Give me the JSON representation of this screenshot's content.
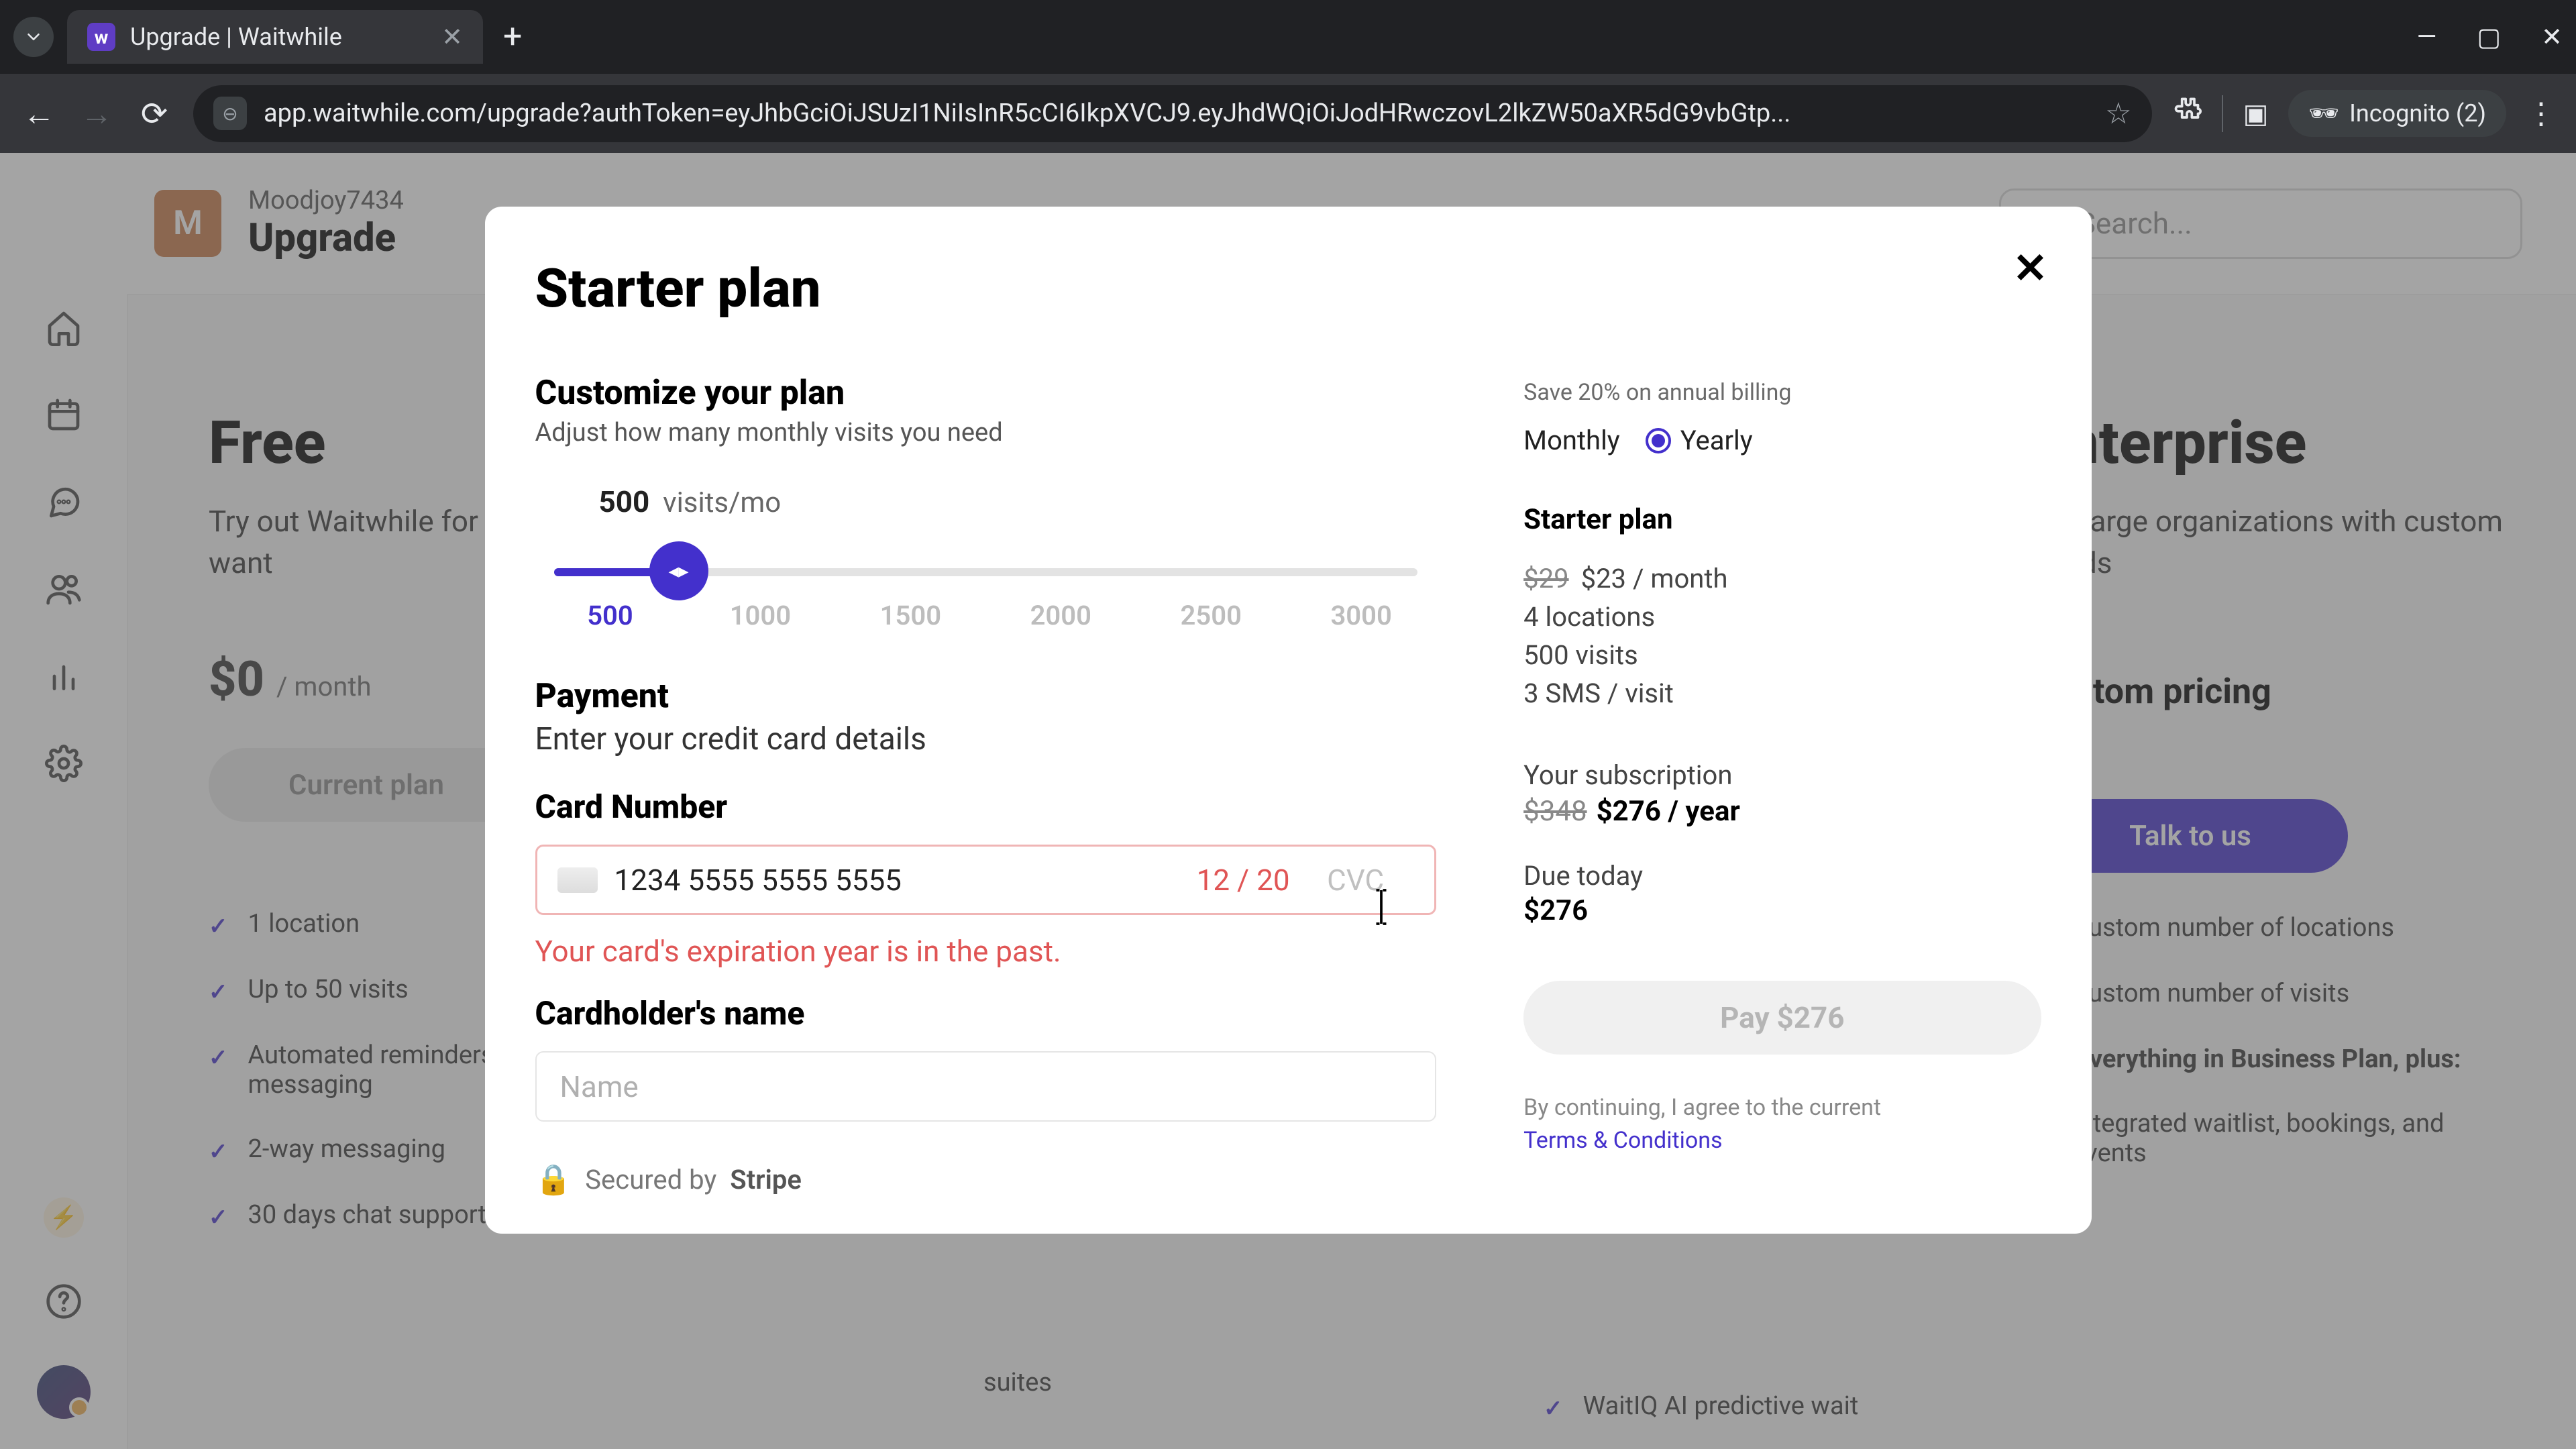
{
  "browser": {
    "tab_title": "Upgrade | Waitwhile",
    "url": "app.waitwhile.com/upgrade?authToken=eyJhbGciOiJSUzI1NiIsInR5cCI6IkpXVCJ9.eyJhdWQiOiJodHRwczovL2lkZW50aXR5dG9vbGtp...",
    "incognito_label": "Incognito (2)"
  },
  "header": {
    "avatar_letter": "M",
    "org_name": "Moodjoy7434",
    "page_title": "Upgrade",
    "search_placeholder": "Search..."
  },
  "bg_free": {
    "title": "Free",
    "subtitle": "Try out Waitwhile for as long as you want",
    "price": "$0",
    "per": "/ month",
    "cta": "Current plan",
    "features": [
      "1 location",
      "Up to 50 visits",
      "Automated reminders & customer messaging",
      "2-way messaging",
      "30 days chat support"
    ]
  },
  "bg_ent": {
    "title": "Enterprise",
    "subtitle": "For large organizations with custom needs",
    "pricing_label": "Custom pricing",
    "cta": "Talk to us",
    "features": [
      "Custom number of locations",
      "Custom number of visits",
      "Everything in Business Plan, plus:",
      "Integrated waitlist, bookings, and events"
    ]
  },
  "bg_hidden": {
    "feat_suites": "suites",
    "feat_waitiq": "WaitIQ AI predictive wait"
  },
  "modal": {
    "title": "Starter plan",
    "customize": {
      "heading": "Customize your plan",
      "sub": "Adjust how many monthly visits you need",
      "visits_value": "500",
      "visits_unit": "visits/mo",
      "slider_labels": [
        "500",
        "1000",
        "1500",
        "2000",
        "2500",
        "3000"
      ]
    },
    "payment": {
      "heading": "Payment",
      "sub": "Enter your credit card details",
      "card_label": "Card Number",
      "card_number": "1234 5555 5555 5555",
      "card_exp": "12 / 20",
      "card_cvc_placeholder": "CVC",
      "error": "Your card's expiration year is in the past.",
      "name_label": "Cardholder's name",
      "name_placeholder": "Name",
      "secured_by": "Secured by",
      "stripe": "Stripe"
    },
    "summary": {
      "save_note": "Save 20% on annual billing",
      "monthly_label": "Monthly",
      "yearly_label": "Yearly",
      "plan_name": "Starter plan",
      "price_strike": "$29",
      "price_current": "$23 / month",
      "locations": "4 locations",
      "visits": "500 visits",
      "sms": "3 SMS / visit",
      "sub_label": "Your subscription",
      "sub_strike": "$348",
      "sub_price": "$276 / year",
      "due_label": "Due today",
      "due_amount": "$276",
      "pay_btn": "Pay $276",
      "agree_prefix": "By continuing, I agree to the current",
      "terms": "Terms & Conditions"
    }
  }
}
